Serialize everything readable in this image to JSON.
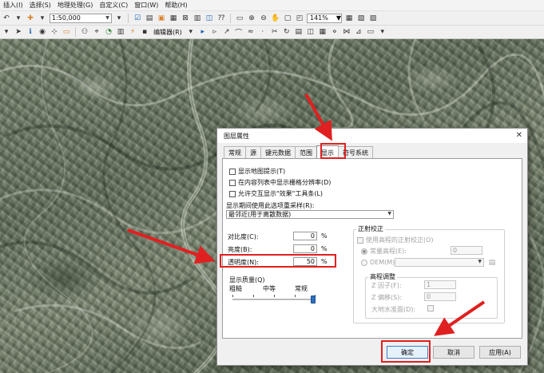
{
  "menubar": {
    "items": [
      "插入(I)",
      "选择(S)",
      "地理处理(G)",
      "自定义(C)",
      "窗口(W)",
      "帮助(H)"
    ]
  },
  "toolbar": {
    "scale_value": "1:50,000",
    "zoom_value": "141%",
    "editor_label": "编辑器(R)"
  },
  "dialog": {
    "title": "图层属性",
    "close_glyph": "✕",
    "tabs": [
      "常规",
      "源",
      "键元数据",
      "范围",
      "显示",
      "符号系统"
    ],
    "active_tab": "显示",
    "checkboxes": {
      "map_tips": "显示地图提示(T)",
      "raster_resolution": "在内容列表中显示栅格分辨率(D)",
      "interactive_effects": "允许交互显示\"效果\"工具条(L)"
    },
    "resample": {
      "label": "显示期间使用此选项重采样(R):",
      "value": "最邻近(用于离散数据)"
    },
    "contrast": {
      "label": "对比度(C):",
      "value": "0",
      "unit": "%"
    },
    "brightness": {
      "label": "亮度(B):",
      "value": "0",
      "unit": "%"
    },
    "transparency": {
      "label": "透明度(N):",
      "value": "50",
      "unit": "%"
    },
    "quality": {
      "title": "显示质量(Q)",
      "low": "粗糙",
      "medium": "中等",
      "normal": "常规",
      "level": 1.0
    },
    "ortho": {
      "title": "正射校正",
      "use_elevation": "使用高程的正射校正(O)",
      "constant_elevation": "常量高程(E):",
      "constant_value": "0",
      "dem": "DEM(M)",
      "elevation_adjust": "高程调整",
      "z_factor": "Z 因子(F):",
      "z_factor_value": "1",
      "z_offset": "Z 偏移(S):",
      "z_offset_value": "0",
      "geoid": "大地水准面(D):"
    },
    "buttons": {
      "ok": "确定",
      "cancel": "取消",
      "apply": "应用(A)"
    }
  },
  "colors": {
    "annotation_red": "#e02020",
    "slider_thumb": "#2d6fc0"
  }
}
